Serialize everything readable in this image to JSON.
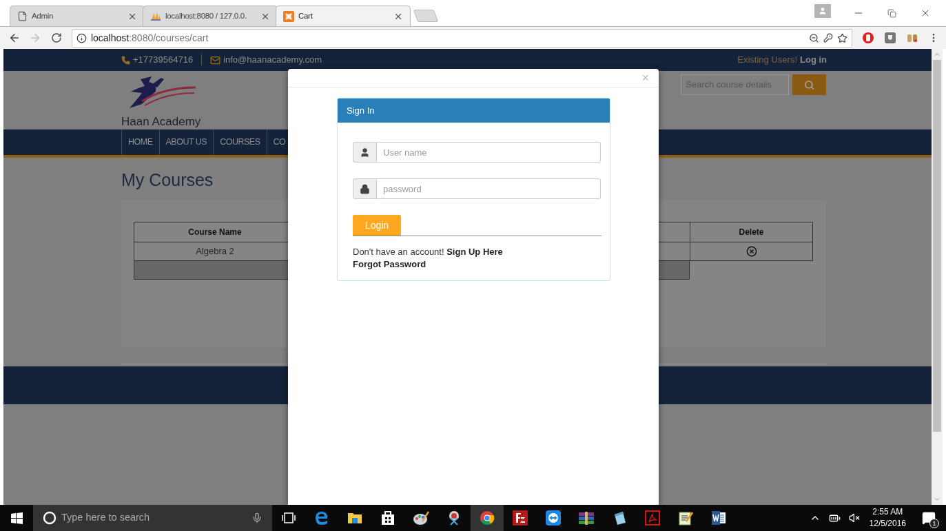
{
  "browser": {
    "tabs": [
      {
        "title": "Admin",
        "kind": "page",
        "selected": false
      },
      {
        "title": "localhost:8080 / 127.0.0.",
        "kind": "pma",
        "selected": false
      },
      {
        "title": "Cart",
        "kind": "xampp",
        "selected": true
      }
    ],
    "address": {
      "host": "localhost",
      "path": ":8080/courses/cart"
    }
  },
  "site": {
    "topbar": {
      "phone": "+17739564716",
      "email": "info@haanacademy.com",
      "prompt": "Existing Users!",
      "login": "Log in"
    },
    "logo_text": "Haan Academy",
    "search": {
      "placeholder": "Search course details"
    },
    "nav": [
      "HOME",
      "ABOUT US",
      "COURSES",
      "CO"
    ],
    "page_title": "My Courses",
    "table": {
      "columns": [
        "Course Name",
        "Delete"
      ],
      "rows": [
        {
          "course": "Algebra 2"
        }
      ]
    }
  },
  "modal": {
    "close": "×",
    "panel_title": "Sign In",
    "fields": [
      {
        "kind": "user",
        "placeholder": "User name"
      },
      {
        "kind": "lock",
        "placeholder": "password"
      }
    ],
    "button": "Login",
    "signup_text": "Don't have an account!",
    "signup_link": "Sign Up Here",
    "forgot": "Forgot Password"
  },
  "taskbar": {
    "search": "Type here to search",
    "time": "2:55 AM",
    "date": "12/5/2016",
    "notifications": "1"
  }
}
